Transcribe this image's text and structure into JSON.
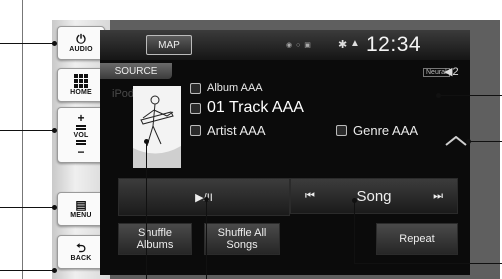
{
  "hardware": {
    "audio_label": "AUDIO",
    "home_label": "HOME",
    "vol_label": "VOL",
    "vol_plus": "+",
    "vol_minus": "−",
    "menu_label": "MENU",
    "back_label": "BACK",
    "power_glyph": "⏻",
    "back_glyph": "⮌"
  },
  "screen": {
    "map_button": "MAP",
    "clock": "12:34",
    "source_tab": "SOURCE",
    "ipod_ghost": "iPod",
    "neural_badge": "Neural",
    "volume_indicator": "◀2",
    "now_playing": {
      "album": "Album AAA",
      "track": "01 Track AAA",
      "artist": "Artist AAA",
      "genre": "Genre AAA"
    },
    "play_pause": "▶/II",
    "song_label": "Song",
    "prev_glyph": "⏮",
    "next_glyph": "⏭",
    "shuffle_albums": "Shuffle Albums",
    "shuffle_all": "Shuffle All Songs",
    "repeat": "Repeat"
  },
  "icons": [
    "power-icon",
    "home-grid-icon",
    "volume-bar-icon",
    "menu-icon",
    "back-arrow-icon",
    "bluetooth-icon",
    "signal-icon",
    "chevron-up-icon"
  ]
}
